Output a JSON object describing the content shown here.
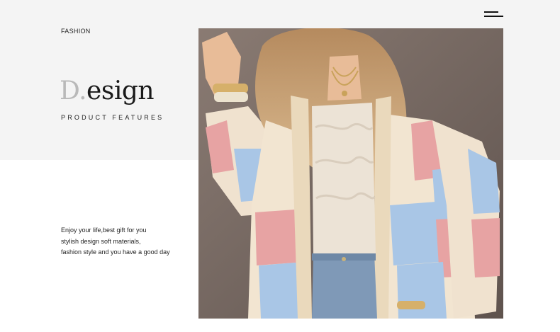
{
  "header": {
    "eyebrow": "FASHION",
    "menu_icon": "hamburger-menu-icon"
  },
  "hero": {
    "title_initial": "D",
    "title_dot": ".",
    "title_rest": "esign",
    "subtitle": "PRODUCT FEATURES"
  },
  "description": {
    "lines": [
      "Enjoy your life,best gift for you",
      "stylish design soft materials,",
      "fashion style and you have a good day"
    ]
  },
  "colors": {
    "top_band": "#f4f4f4",
    "title_initial": "#b9b9b9",
    "text": "#222222"
  }
}
